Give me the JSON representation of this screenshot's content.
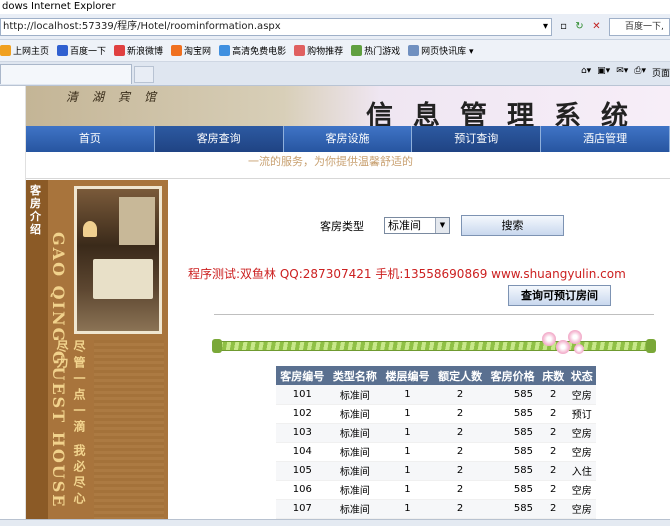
{
  "browser": {
    "title": "dows Internet Explorer",
    "url": "http://localhost:57339/程序/Hotel/roominformation.aspx",
    "search_placeholder": "百度一下,",
    "favorites": [
      "上网主页",
      "百度一下",
      "新浪微博",
      "淘宝网",
      "高清免费电影",
      "购物推荐",
      "热门游戏",
      "网页快讯库 ▾"
    ],
    "tools_label": "页面"
  },
  "banner": {
    "hotel_name": "清湖宾馆",
    "system_title": "信息管理系统"
  },
  "nav": [
    "首页",
    "客房查询",
    "客房设施",
    "预订查询",
    "酒店管理"
  ],
  "slogan": "一流的服务，为你提供温馨舒适的",
  "sidebar": {
    "title": "客房介绍",
    "english": "GAO QING GUEST HOUSE",
    "motto": "尽管一点一滴 我必尽心尽力"
  },
  "search": {
    "label": "客房类型",
    "selected": "标准间",
    "button": "搜索"
  },
  "contact_text": "程序测试:双鱼林 QQ:287307421 手机:13558690869 www.shuangyulin.com",
  "reserve_button": "查询可预订房间",
  "table": {
    "headers": [
      "客房编号",
      "类型名称",
      "楼层编号",
      "额定人数",
      "客房价格",
      "床数",
      "状态"
    ],
    "rows": [
      [
        "101",
        "标准间",
        "1",
        "2",
        "585",
        "2",
        "空房"
      ],
      [
        "102",
        "标准间",
        "1",
        "2",
        "585",
        "2",
        "预订"
      ],
      [
        "103",
        "标准间",
        "1",
        "2",
        "585",
        "2",
        "空房"
      ],
      [
        "104",
        "标准间",
        "1",
        "2",
        "585",
        "2",
        "空房"
      ],
      [
        "105",
        "标准间",
        "1",
        "2",
        "585",
        "2",
        "入住"
      ],
      [
        "106",
        "标准间",
        "1",
        "2",
        "585",
        "2",
        "空房"
      ],
      [
        "107",
        "标准间",
        "1",
        "2",
        "585",
        "2",
        "空房"
      ]
    ]
  },
  "colors": {
    "nav_bg": "#2c5fae",
    "sidebar_bg": "#a8743c",
    "contact_text": "#cc2020",
    "table_header": "#5a7090"
  }
}
